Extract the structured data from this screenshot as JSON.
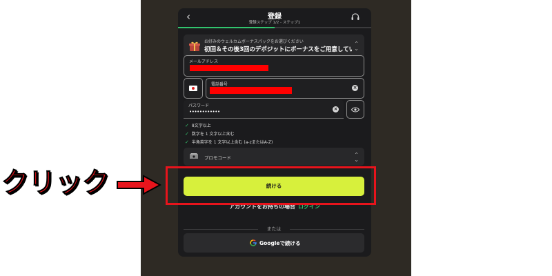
{
  "header": {
    "back_glyph": "‹",
    "title": "登録",
    "subtitle": "登録ステップ 1/2 - ステップ1",
    "progress_fraction": 0.5,
    "back_icon": "chevron-left-icon",
    "support_icon": "headset-icon"
  },
  "bonus": {
    "icon": "gift-icon",
    "caption": "お好みのウェルカムボーナスパックをお選びください",
    "selection": "初回＆その後3回のデポジットにボーナスをご用意してい…",
    "chevron_icon": "chevron-updown-icon"
  },
  "form": {
    "email_label": "メールアドレス",
    "phone_label": "電話番号",
    "phone_country_icon": "japan-flag-icon",
    "password_label": "パスワード",
    "password_mask": "••••••••••••",
    "clear_glyph": "×",
    "eye_icon": "eye-icon"
  },
  "password_rules": [
    "8文字以上",
    "数字を 1 文字以上含む",
    "半角英字を 1 文字以上含む (a-zまたはA-Z)"
  ],
  "promo": {
    "icon": "promo-ticket-icon",
    "label": "プロモコード"
  },
  "continue_label": "続ける",
  "login_prompt": "アカウントをお持ちの場合",
  "login_link": "ログイン",
  "or_text": "または",
  "google_label": "Googleで続ける",
  "annotation": {
    "callout_text": "クリック",
    "arrow_icon": "arrow-right-icon",
    "highlight_color": "#e8141c"
  },
  "colors": {
    "accent_green": "#31c46d",
    "button_lime": "#d7f03c",
    "modal_bg": "#1b1b1d",
    "redaction": "#ff0000"
  }
}
